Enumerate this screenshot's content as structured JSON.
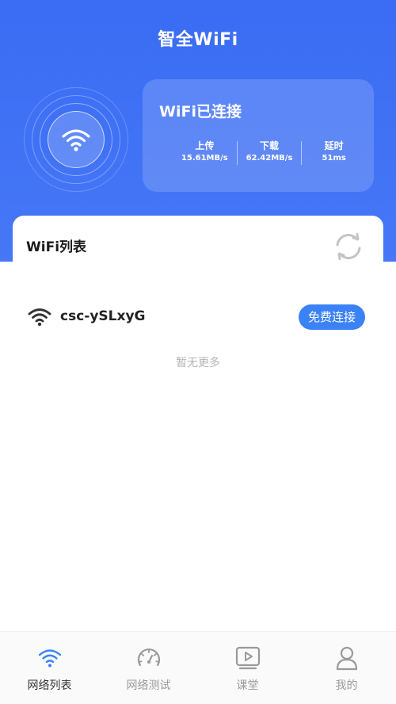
{
  "app": {
    "title": "智全WiFi"
  },
  "status": {
    "title": "WiFi已连接",
    "stats": [
      {
        "label": "上传",
        "value": "15.61MB/s"
      },
      {
        "label": "下载",
        "value": "62.42MB/s"
      },
      {
        "label": "延时",
        "value": "51ms"
      }
    ]
  },
  "wifi_list": {
    "title": "WiFi列表",
    "networks": [
      {
        "ssid": "csc-ySLxyG",
        "action_label": "免费连接"
      }
    ],
    "empty_tip": "暂无更多"
  },
  "tabs": [
    {
      "label": "网络列表",
      "icon": "wifi-icon",
      "active": true
    },
    {
      "label": "网络测试",
      "icon": "speedometer-icon",
      "active": false
    },
    {
      "label": "课堂",
      "icon": "video-play-icon",
      "active": false
    },
    {
      "label": "我的",
      "icon": "user-icon",
      "active": false
    }
  ],
  "colors": {
    "primary": "#3a6cf4",
    "button": "#3b82f6",
    "muted_text": "#b4b4b4"
  }
}
